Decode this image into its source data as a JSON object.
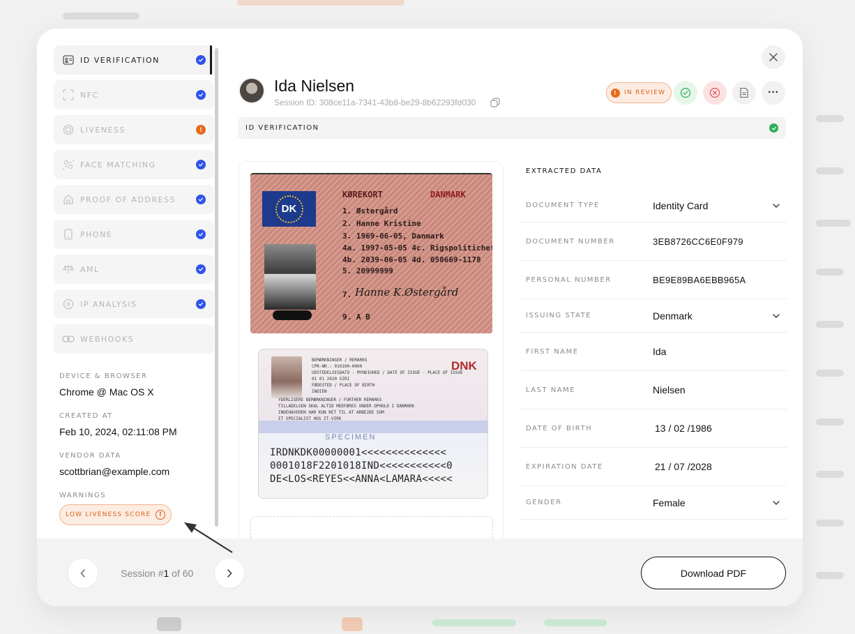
{
  "sidebar": {
    "steps": [
      {
        "label": "ID VERIFICATION",
        "status": "verified",
        "icon": "id-card-icon"
      },
      {
        "label": "NFC",
        "status": "verified",
        "icon": "nfc-icon"
      },
      {
        "label": "LIVENESS",
        "status": "warning",
        "icon": "face-scan-icon"
      },
      {
        "label": "FACE MATCHING",
        "status": "verified",
        "icon": "face-match-icon"
      },
      {
        "label": "PROOF OF ADDRESS",
        "status": "verified",
        "icon": "home-document-icon"
      },
      {
        "label": "PHONE",
        "status": "verified",
        "icon": "phone-icon"
      },
      {
        "label": "AML",
        "status": "verified",
        "icon": "aml-icon"
      },
      {
        "label": "IP ANALYSIS",
        "status": "verified",
        "icon": "ip-icon"
      },
      {
        "label": "WEBHOOKS",
        "status": "none",
        "icon": "link-icon"
      }
    ],
    "device_label": "DEVICE & BROWSER",
    "device_value": "Chrome @ Mac OS X",
    "created_label": "CREATED AT",
    "created_value": "Feb 10, 2024, 02:11:08 PM",
    "vendor_label": "VENDOR DATA",
    "vendor_value": "scottbrian@example.com",
    "warnings_label": "WARNINGS",
    "warning_badge": "LOW LIVENESS SCORE"
  },
  "header": {
    "name": "Ida Nielsen",
    "session_id": "Session ID: 308ce11a-7341-43b8-be29-8b62293fd030",
    "status_badge": "IN REVIEW"
  },
  "section": {
    "title": "ID VERIFICATION"
  },
  "document": {
    "front": {
      "country_code": "DK",
      "title_left": "KØREKORT",
      "title_right": "DANMARK",
      "lines": [
        "1.  Østergård",
        "2.  Hanne Kristine",
        "3.  1969-06-05, Danmark",
        "4a. 1997-05-05  4c. Rigspolitichefen",
        "4b. 2039-06-05  4d. 050669-1178",
        "5.  20999999"
      ],
      "line7": "7.",
      "signature": "Hanne K.Østergård",
      "line9": "9.  A B"
    },
    "back": {
      "country": "DNK",
      "small_lines": [
        "BEMÆRKNINGER / REMARKS",
        "CPR-NR.: 010100-0000",
        "UDSTEDELSESDATO - MYNDIGHED / DATE OF ISSUE - PLACE OF ISSUE",
        "01 01 2020 SIRI",
        "FØDESTED / PLACE OF BIRTH",
        "INDIEN",
        "YDERLIGERE BEMÆRKNINGER / FURTHER REMARKS",
        "TILLADELSEN SKAL ALTID MEDFØRES UNDER OPHOLD I DANMARK",
        "INDEHAVEREN HAR KUN RET TIL AT ARBEJDE SOM",
        "IT SPECIALIST HOS IT-VIRK"
      ],
      "specimen": "SPECIMEN",
      "mrz": [
        "IRDNKDK00000001<<<<<<<<<<<<<<",
        "0001018F2201018IND<<<<<<<<<<<0",
        "DE<LOS<REYES<<ANNA<LAMARA<<<<<"
      ]
    }
  },
  "extracted": {
    "title": "EXTRACTED DATA",
    "rows": [
      {
        "label": "DOCUMENT TYPE",
        "value": "Identity Card",
        "dropdown": true
      },
      {
        "label": "DOCUMENT NUMBER",
        "value": "3EB8726CC6E0F979",
        "dropdown": false
      },
      {
        "label": "PERSONAL NUMBER",
        "value": "BE9E89BA6EBB965A",
        "dropdown": false
      },
      {
        "label": "ISSUING STATE",
        "value": "Denmark",
        "dropdown": true
      },
      {
        "label": "FIRST NAME",
        "value": "Ida",
        "dropdown": false
      },
      {
        "label": "LAST NAME",
        "value": "Nielsen",
        "dropdown": false
      },
      {
        "label": "DATE OF BIRTH",
        "value": "13 / 02 /1986",
        "dropdown": false
      },
      {
        "label": "EXPIRATION DATE",
        "value": "21 / 07 /2028",
        "dropdown": false
      },
      {
        "label": "GENDER",
        "value": "Female",
        "dropdown": true
      }
    ]
  },
  "footer": {
    "session_prefix": "Session #",
    "session_current": "1",
    "session_suffix": " of 60",
    "download_label": "Download PDF"
  },
  "colors": {
    "verified": "#2f54eb",
    "warning": "#e56a1d",
    "approve": "#2fae57",
    "reject": "#e05252"
  }
}
